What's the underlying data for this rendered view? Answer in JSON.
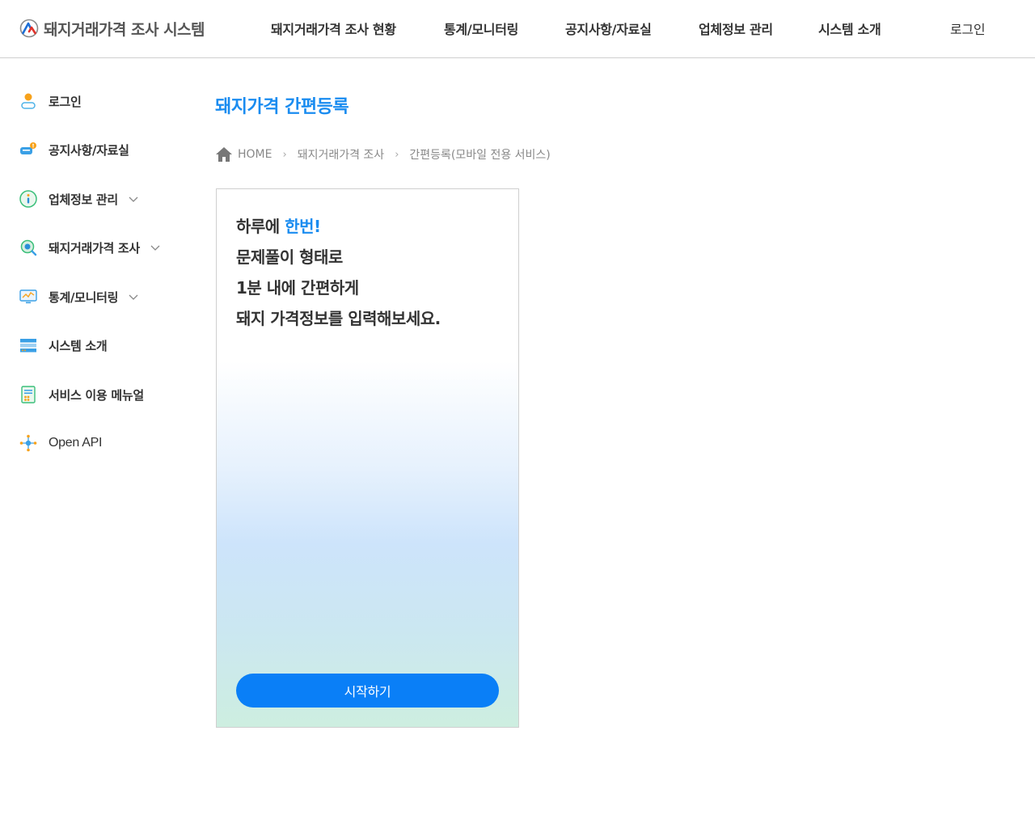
{
  "header": {
    "logo_text": "돼지거래가격 조사 시스템",
    "nav": [
      {
        "label": "돼지거래가격 조사 현황"
      },
      {
        "label": "통계/모니터링"
      },
      {
        "label": "공지사항/자료실"
      },
      {
        "label": "업체정보 관리"
      },
      {
        "label": "시스템 소개"
      }
    ],
    "login_label": "로그인"
  },
  "sidebar": {
    "items": [
      {
        "label": "로그인",
        "icon": "user-icon"
      },
      {
        "label": "공지사항/자료실",
        "icon": "notice-icon"
      },
      {
        "label": "업체정보 관리",
        "icon": "info-icon",
        "has_submenu": true
      },
      {
        "label": "돼지거래가격 조사",
        "icon": "search-icon",
        "has_submenu": true
      },
      {
        "label": "통계/모니터링",
        "icon": "monitor-chart-icon",
        "has_submenu": true
      },
      {
        "label": "시스템 소개",
        "icon": "server-icon"
      },
      {
        "label": "서비스 이용 메뉴얼",
        "icon": "manual-icon"
      },
      {
        "label": "Open API",
        "icon": "network-icon"
      }
    ]
  },
  "main": {
    "title": "돼지가격 간편등록",
    "breadcrumb": [
      "HOME",
      "돼지거래가격 조사",
      "간편등록(모바일 전용 서비스)"
    ],
    "card": {
      "line1_prefix": "하루에 ",
      "line1_accent": "한번!",
      "line2": "문제풀이 형태로",
      "line3": "1분 내에 간편하게",
      "line4": "돼지 가격정보를 입력해보세요.",
      "button_label": "시작하기"
    }
  },
  "colors": {
    "accent": "#1a8cf0",
    "button": "#0a7ff7",
    "text": "#333333"
  }
}
